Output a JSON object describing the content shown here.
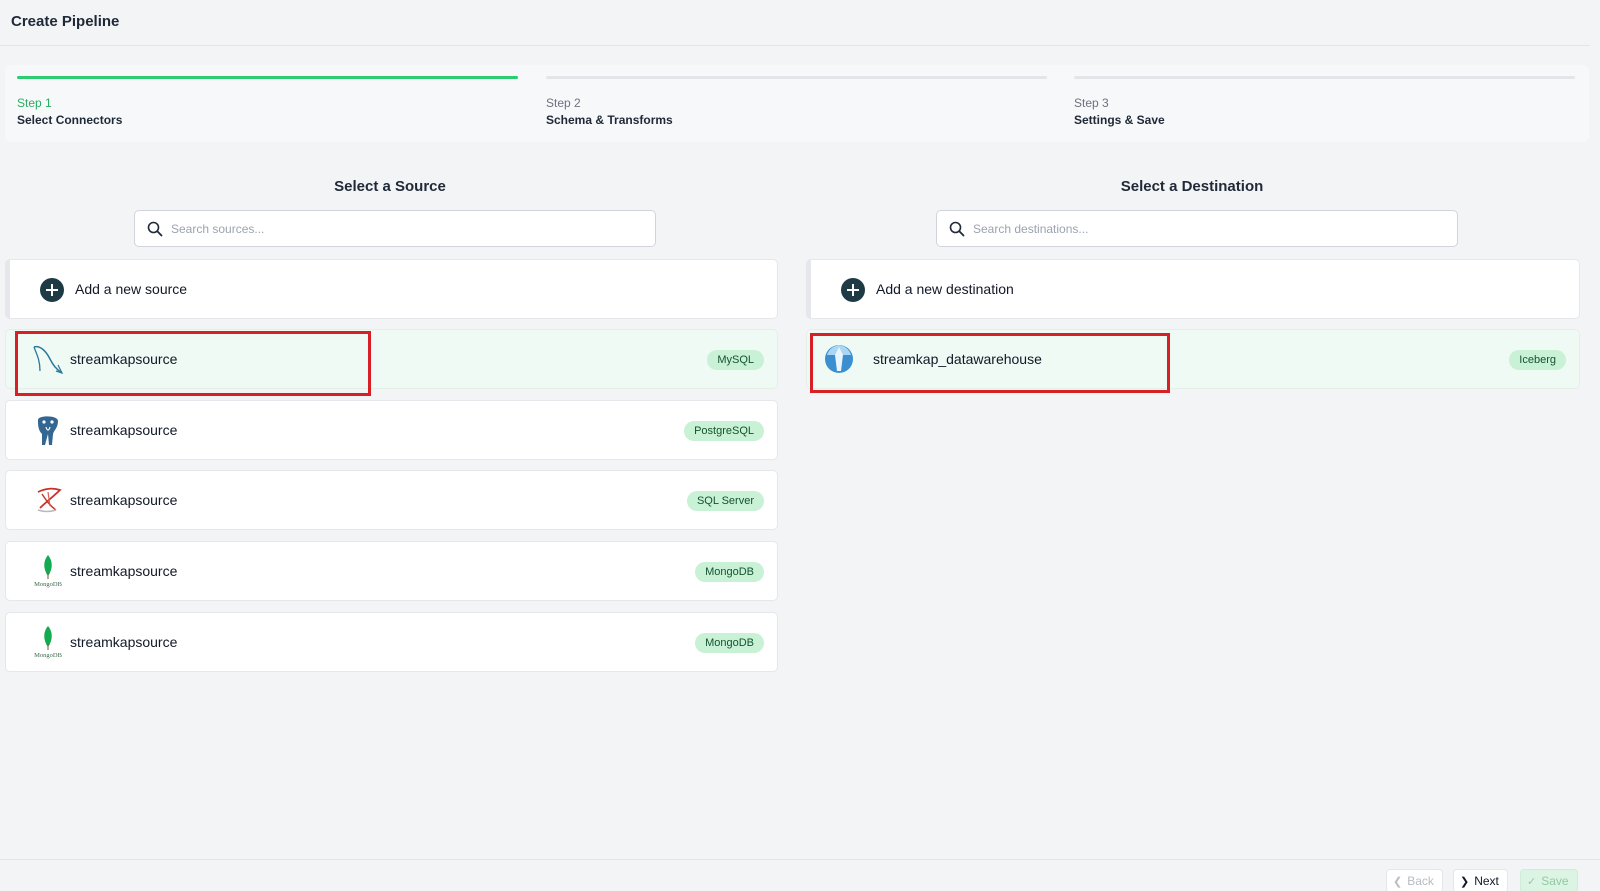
{
  "header": {
    "title": "Create Pipeline"
  },
  "steps": [
    {
      "number": "Step 1",
      "name": "Select Connectors",
      "active": true
    },
    {
      "number": "Step 2",
      "name": "Schema & Transforms",
      "active": false
    },
    {
      "number": "Step 3",
      "name": "Settings & Save",
      "active": false
    }
  ],
  "source": {
    "title": "Select a Source",
    "search_placeholder": "Search sources...",
    "add_label": "Add a new source",
    "items": [
      {
        "name": "streamkapsource",
        "type": "MySQL",
        "icon": "mysql-icon",
        "selected": true
      },
      {
        "name": "streamkapsource",
        "type": "PostgreSQL",
        "icon": "postgresql-icon",
        "selected": false
      },
      {
        "name": "streamkapsource",
        "type": "SQL Server",
        "icon": "sql-server-icon",
        "selected": false
      },
      {
        "name": "streamkapsource",
        "type": "MongoDB",
        "icon": "mongodb-icon",
        "icon_text": "MongoDB",
        "selected": false
      },
      {
        "name": "streamkapsource",
        "type": "MongoDB",
        "icon": "mongodb-icon",
        "icon_text": "MongoDB",
        "selected": false
      }
    ]
  },
  "destination": {
    "title": "Select a Destination",
    "search_placeholder": "Search destinations...",
    "add_label": "Add a new destination",
    "items": [
      {
        "name": "streamkap_datawarehouse",
        "type": "Iceberg",
        "icon": "iceberg-icon",
        "selected": true
      }
    ]
  },
  "footer": {
    "back_label": "Back",
    "next_label": "Next",
    "save_label": "Save"
  },
  "colors": {
    "accent_green": "#2ecc71",
    "badge_bg": "#c8f1d5",
    "selected_bg": "#eefaf3",
    "highlight_red": "#d91f26"
  }
}
